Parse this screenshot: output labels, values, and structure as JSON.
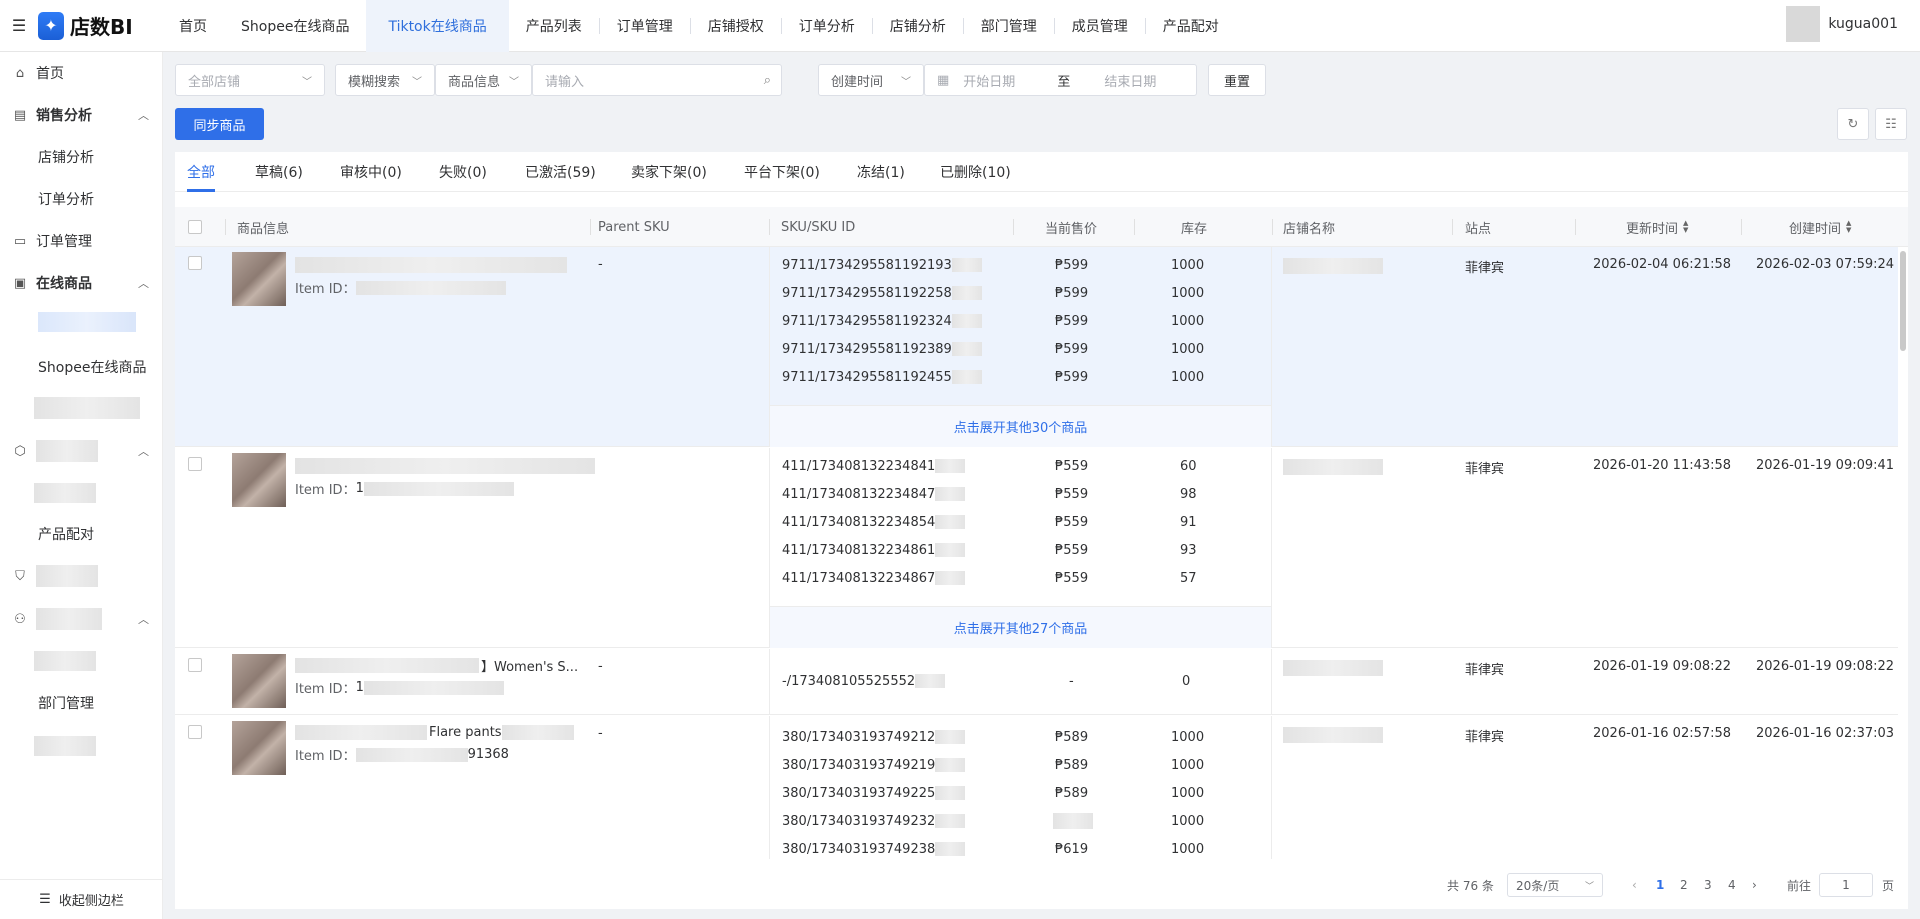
{
  "app": {
    "logo_text": "店数BI",
    "logo_glyph": "✦"
  },
  "topnav": [
    {
      "label": "首页"
    },
    {
      "label": "Shopee在线商品"
    },
    {
      "label": "Tiktok在线商品"
    },
    {
      "label": "产品列表"
    },
    {
      "label": "订单管理"
    },
    {
      "label": "店铺授权"
    },
    {
      "label": "订单分析"
    },
    {
      "label": "店铺分析"
    },
    {
      "label": "部门管理"
    },
    {
      "label": "成员管理"
    },
    {
      "label": "产品配对"
    }
  ],
  "user": {
    "name": "kugua001"
  },
  "sidebar": {
    "home": "首页",
    "sales": "销售分析",
    "shop_analysis": "店铺分析",
    "order_analysis": "订单分析",
    "order_mgmt": "订单管理",
    "online_goods": "在线商品",
    "shopee_online": "Shopee在线商品",
    "product_match": "产品配对",
    "dept_mgmt": "部门管理",
    "collapse": "收起侧边栏"
  },
  "filters": {
    "all_shops": "全部店铺",
    "fuzzy": "模糊搜索",
    "goods_info": "商品信息",
    "input_placeholder": "请输入",
    "create_time": "创建时间",
    "start_date": "开始日期",
    "to": "至",
    "end_date": "结束日期",
    "reset": "重置"
  },
  "actions": {
    "sync": "同步商品"
  },
  "tabs": [
    {
      "label": "全部"
    },
    {
      "label": "草稿(6)"
    },
    {
      "label": "审核中(0)"
    },
    {
      "label": "失败(0)"
    },
    {
      "label": "已激活(59)"
    },
    {
      "label": "卖家下架(0)"
    },
    {
      "label": "平台下架(0)"
    },
    {
      "label": "冻结(1)"
    },
    {
      "label": "已删除(10)"
    }
  ],
  "columns": {
    "goods_info": "商品信息",
    "parent_sku": "Parent SKU",
    "sku": "SKU/SKU ID",
    "price": "当前售价",
    "stock": "库存",
    "shop": "店铺名称",
    "site": "站点",
    "updated": "更新时间",
    "created": "创建时间"
  },
  "rows": [
    {
      "name": "",
      "item_id_label": "Item ID：",
      "item_id": "",
      "parent_sku": "-",
      "skus": [
        {
          "sku": "9711/1734295581192193",
          "price": "₱599",
          "stock": "1000"
        },
        {
          "sku": "9711/1734295581192258",
          "price": "₱599",
          "stock": "1000"
        },
        {
          "sku": "9711/1734295581192324",
          "price": "₱599",
          "stock": "1000"
        },
        {
          "sku": "9711/1734295581192389",
          "price": "₱599",
          "stock": "1000"
        },
        {
          "sku": "9711/1734295581192455",
          "price": "₱599",
          "stock": "1000"
        }
      ],
      "expand": "点击展开其他30个商品",
      "site": "菲律宾",
      "updated": "2026-02-04 06:21:58",
      "created": "2026-02-03 07:59:24"
    },
    {
      "name": "",
      "item_id_label": "Item ID：",
      "item_id": "1",
      "parent_sku": "",
      "skus": [
        {
          "sku": "411/173408132234841",
          "price": "₱559",
          "stock": "60"
        },
        {
          "sku": "411/173408132234847",
          "price": "₱559",
          "stock": "98"
        },
        {
          "sku": "411/173408132234854",
          "price": "₱559",
          "stock": "91"
        },
        {
          "sku": "411/173408132234861",
          "price": "₱559",
          "stock": "93"
        },
        {
          "sku": "411/173408132234867",
          "price": "₱559",
          "stock": "57"
        }
      ],
      "expand": "点击展开其他27个商品",
      "site": "菲律宾",
      "updated": "2026-01-20 11:43:58",
      "created": "2026-01-19 09:09:41"
    },
    {
      "name": "】Women's S...",
      "item_id_label": "Item ID：",
      "item_id": "1",
      "parent_sku": "-",
      "skus": [
        {
          "sku": "-/173408105525552",
          "price": "-",
          "stock": "0"
        }
      ],
      "site": "菲律宾",
      "updated": "2026-01-19 09:08:22",
      "created": "2026-01-19 09:08:22"
    },
    {
      "name": "Flare pants",
      "item_id_label": "Item ID：",
      "item_id": "91368",
      "parent_sku": "-",
      "skus": [
        {
          "sku": "380/173403193749212",
          "price": "₱589",
          "stock": "1000"
        },
        {
          "sku": "380/173403193749219",
          "price": "₱589",
          "stock": "1000"
        },
        {
          "sku": "380/173403193749225",
          "price": "₱589",
          "stock": "1000"
        },
        {
          "sku": "380/173403193749232",
          "price": "",
          "stock": "1000"
        },
        {
          "sku": "380/173403193749238",
          "price": "₱619",
          "stock": "1000"
        }
      ],
      "site": "菲律宾",
      "updated": "2026-01-16 02:57:58",
      "created": "2026-01-16 02:37:03"
    }
  ],
  "pagination": {
    "total": "共 76 条",
    "page_size": "20条/页",
    "pages": [
      "1",
      "2",
      "3",
      "4"
    ],
    "goto_label": "前往",
    "goto_value": "1",
    "page_suffix": "页"
  },
  "colors": {
    "accent": "#2f6fe8",
    "row_highlight": "#edf3fd"
  }
}
